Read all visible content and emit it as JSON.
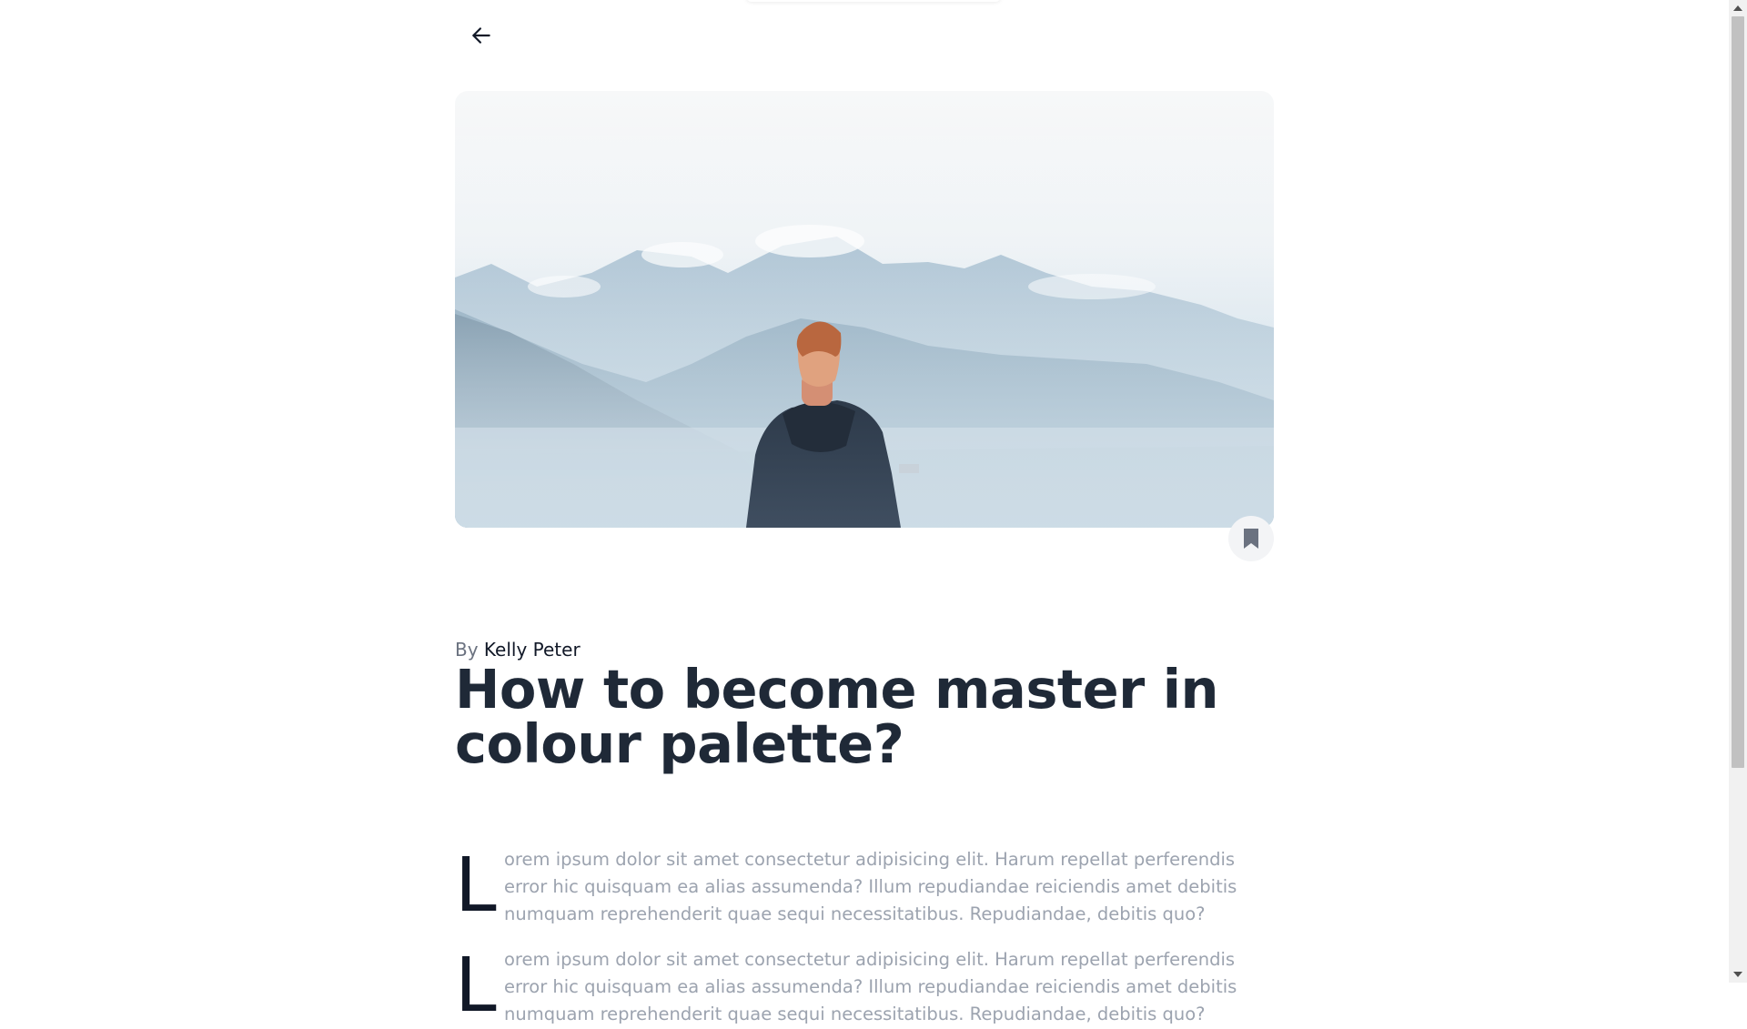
{
  "article": {
    "byline_prefix": "By",
    "author": "Kelly Peter",
    "title": "How to become master in colour palette?",
    "paragraphs": [
      {
        "drop_cap": "L",
        "text": "orem ipsum dolor sit amet consectetur adipisicing elit. Harum repellat perferendis error hic quisquam ea alias assumenda? Illum repudiandae reiciendis amet debitis numquam reprehenderit quae sequi necessitatibus. Repudiandae, debitis quo?"
      },
      {
        "drop_cap": "L",
        "text": "orem ipsum dolor sit amet consectetur adipisicing elit. Harum repellat perferendis error hic quisquam ea alias assumenda? Illum repudiandae reiciendis amet debitis numquam reprehenderit quae sequi necessitatibus. Repudiandae, debitis quo?"
      }
    ]
  },
  "icons": {
    "back": "arrow-left-icon",
    "bookmark": "bookmark-icon"
  },
  "colors": {
    "title": "#1f2937",
    "body_text": "#9ca3af",
    "byline": "#6b7280",
    "bookmark_bg": "#f3f4f6",
    "bookmark_icon": "#6b7280"
  }
}
